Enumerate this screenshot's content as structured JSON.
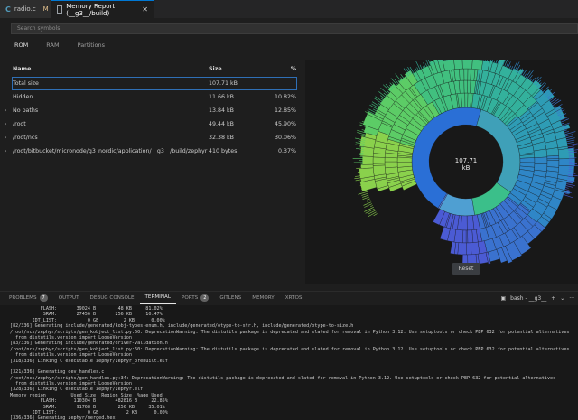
{
  "tabs": [
    {
      "label": "radio.c",
      "badge": "M"
    },
    {
      "label": "Memory Report (__g3__/build)"
    }
  ],
  "search": {
    "placeholder": "Search symbols"
  },
  "subtabs": [
    "ROM",
    "RAM",
    "Partitions"
  ],
  "table": {
    "headers": {
      "name": "Name",
      "size": "Size",
      "pct": "%"
    },
    "rows": [
      {
        "name": "Total size",
        "size": "107.71 kB",
        "pct": "",
        "expandable": false
      },
      {
        "name": "Hidden",
        "size": "11.66 kB",
        "pct": "10.82%",
        "expandable": false
      },
      {
        "name": "No paths",
        "size": "13.84 kB",
        "pct": "12.85%",
        "expandable": true
      },
      {
        "name": "/root",
        "size": "49.44 kB",
        "pct": "45.90%",
        "expandable": true
      },
      {
        "name": "/root/ncs",
        "size": "32.38 kB",
        "pct": "30.06%",
        "expandable": true
      },
      {
        "name": "/root/bitbucket/micronode/g3_nordic/application/__g3__/build/zephyr",
        "size": "410 bytes",
        "pct": "0.37%",
        "expandable": true
      }
    ]
  },
  "chart": {
    "center_label": "107.71 kB",
    "reset_label": "Reset"
  },
  "panel": {
    "tabs": [
      {
        "label": "PROBLEMS",
        "badge": "7"
      },
      {
        "label": "OUTPUT"
      },
      {
        "label": "DEBUG CONSOLE"
      },
      {
        "label": "TERMINAL",
        "active": true
      },
      {
        "label": "PORTS",
        "badge": "2"
      },
      {
        "label": "GITLENS"
      },
      {
        "label": "MEMORY"
      },
      {
        "label": "XRTOS"
      }
    ],
    "terminal_name": "bash - __g3__"
  },
  "terminal_lines": [
    "           FLASH:       39024 B        48 KB     81.02%",
    "            SRAM:       27456 B       256 KB     10.47%",
    "        IDT_LIST:           0 GB         2 KB      0.00%",
    "[82/336] Generating include/generated/kobj-types-enum.h, include/generated/otype-to-str.h, include/generated/otype-to-size.h",
    "/root/ncs/zephyr/scripts/gen_kobject_list.py:60: DeprecationWarning: The distutils package is deprecated and slated for removal in Python 3.12. Use setuptools or check PEP 632 for potential alternatives",
    "  from distutils.version import LooseVersion",
    "[83/336] Generating include/generated/driver-validation.h",
    "/root/ncs/zephyr/scripts/gen_kobject_list.py:60: DeprecationWarning: The distutils package is deprecated and slated for removal in Python 3.12. Use setuptools or check PEP 632 for potential alternatives",
    "  from distutils.version import LooseVersion",
    "[318/336] Linking C executable zephyr/zephyr_prebuilt.elf",
    "",
    "[321/336] Generating dev_handles.c",
    "/root/ncs/zephyr/scripts/gen_handles.py:34: DeprecationWarning: The distutils package is deprecated and slated for removal in Python 3.12. Use setuptools or check PEP 632 for potential alternatives",
    "  from distutils.version import LooseVersion",
    "[328/336] Linking C executable zephyr/zephyr.elf",
    "Memory region         Used Size  Region Size  %age Used",
    "           FLASH:      110304 B       482816 B     22.85%",
    "            SRAM:       91768 B        256 KB     35.01%",
    "        IDT_LIST:           0 GB          2 KB      0.00%",
    "[336/336] Generating zephyr/merged.hex"
  ],
  "chart_data": {
    "type": "pie",
    "title": "",
    "center_label": "107.71 kB",
    "categories": [
      "/root",
      "/root/ncs",
      "No paths",
      "Hidden",
      "/root/bitbucket/micronode/g3_nordic/application/__g3__/build/zephyr"
    ],
    "values": [
      45.9,
      30.06,
      12.85,
      10.82,
      0.37
    ],
    "unit": "%"
  },
  "colors": {
    "accent": "#0078d4",
    "background": "#1e1e1e",
    "chart_bg": "#181818"
  }
}
